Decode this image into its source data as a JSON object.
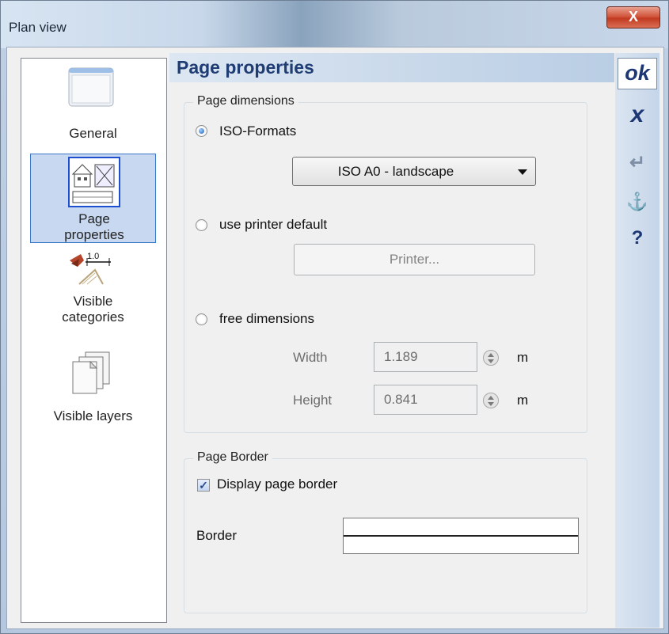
{
  "window": {
    "title": "Plan view",
    "close_label": "X"
  },
  "sidebar": {
    "items": [
      {
        "label": "General",
        "icon": "window-icon",
        "selected": false
      },
      {
        "label": "Page properties",
        "icon": "page-layout-icon",
        "selected": true
      },
      {
        "label": "Visible categories",
        "icon": "categories-icon",
        "selected": false
      },
      {
        "label": "Visible layers",
        "icon": "layers-icon",
        "selected": false
      }
    ]
  },
  "panel": {
    "title": "Page properties",
    "page_dimensions": {
      "legend": "Page dimensions",
      "iso_radio_label": "ISO-Formats",
      "iso_selected": true,
      "iso_select_value": "ISO A0 - landscape",
      "printer_radio_label": "use printer default",
      "printer_button_label": "Printer...",
      "free_radio_label": "free dimensions",
      "width_label": "Width",
      "width_value": "1.189",
      "width_unit": "m",
      "height_label": "Height",
      "height_value": "0.841",
      "height_unit": "m"
    },
    "page_border": {
      "legend": "Page Border",
      "display_label": "Display page border",
      "display_checked": true,
      "border_label": "Border"
    }
  },
  "rightbar": {
    "ok_label": "ok",
    "cancel_label": "x",
    "apply_symbol": "↵",
    "anchor_symbol": "⚓",
    "help_label": "?"
  }
}
